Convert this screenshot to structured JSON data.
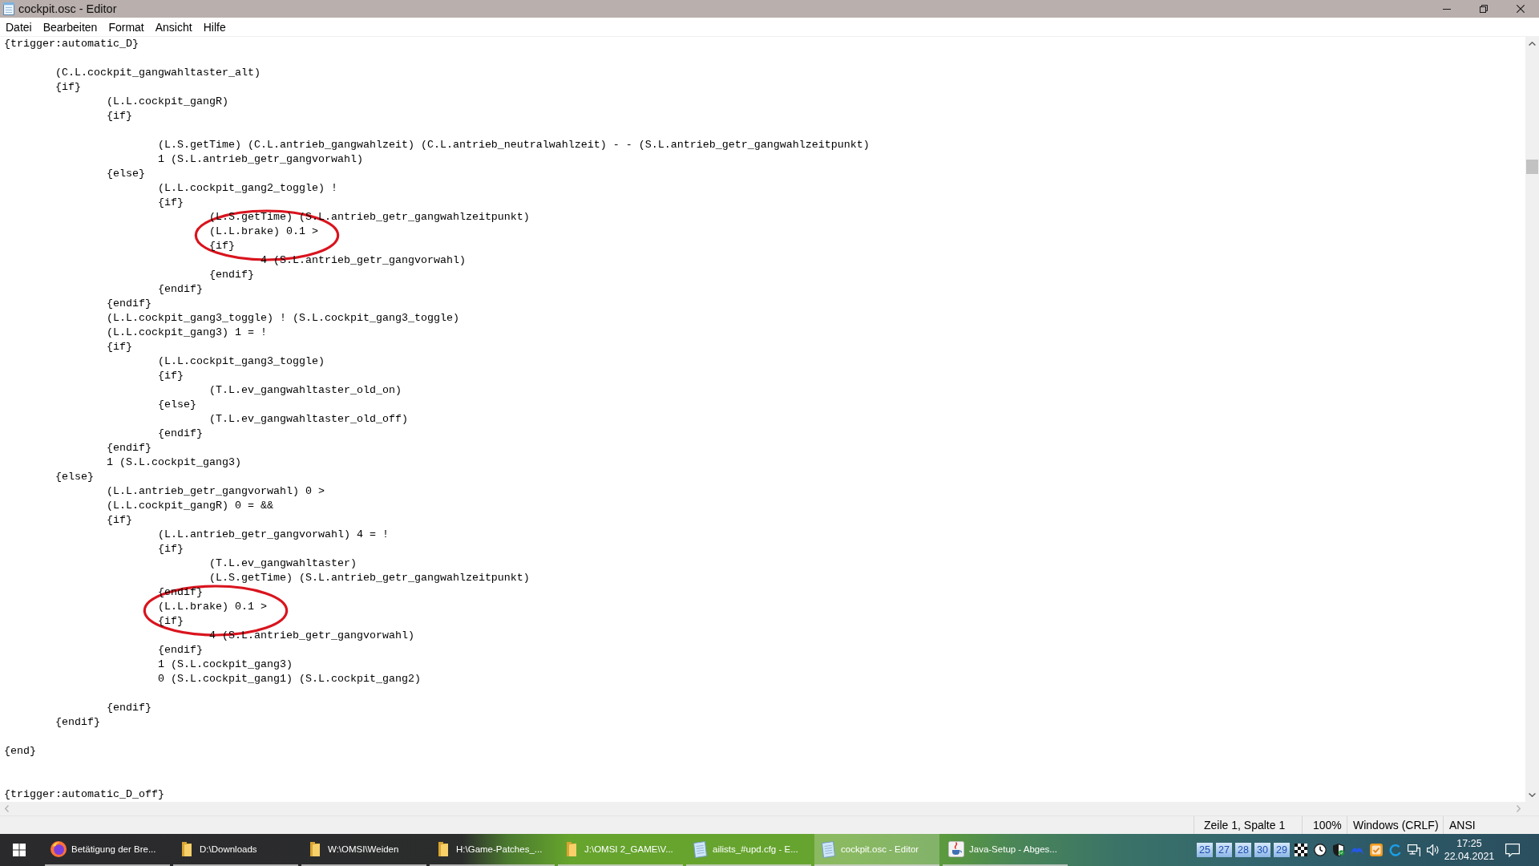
{
  "window": {
    "title": "cockpit.osc - Editor"
  },
  "menu": [
    "Datei",
    "Bearbeiten",
    "Format",
    "Ansicht",
    "Hilfe"
  ],
  "editor": {
    "lines": [
      {
        "kind": "code",
        "text": "{trigger:automatic_D}",
        "circled": false
      },
      {
        "kind": "blank"
      },
      {
        "kind": "code",
        "text": "\t(C.L.cockpit_gangwahltaster_alt)",
        "circled": false
      },
      {
        "kind": "code",
        "text": "\t{if}",
        "circled": false
      },
      {
        "kind": "code",
        "text": "\t\t(L.L.cockpit_gangR)",
        "circled": false
      },
      {
        "kind": "code",
        "text": "\t\t{if}",
        "circled": false
      },
      {
        "kind": "blank"
      },
      {
        "kind": "code",
        "text": "\t\t\t(L.S.getTime) (C.L.antrieb_gangwahlzeit) (C.L.antrieb_neutralwahlzeit) - - (S.L.antrieb_getr_gangwahlzeitpunkt)",
        "circled": false
      },
      {
        "kind": "code",
        "text": "\t\t\t1 (S.L.antrieb_getr_gangvorwahl)",
        "circled": false
      },
      {
        "kind": "code",
        "text": "\t\t{else}",
        "circled": false
      },
      {
        "kind": "code",
        "text": "\t\t\t(L.L.cockpit_gang2_toggle) !",
        "circled": false
      },
      {
        "kind": "code",
        "text": "\t\t\t{if}",
        "circled": false
      },
      {
        "kind": "code",
        "text": "\t\t\t\t(L.S.getTime) (S.L.antrieb_getr_gangwahlzeitpunkt)",
        "circled": false
      },
      {
        "kind": "code",
        "text": "\t\t\t\t(L.L.brake) 0.1 >",
        "circled": true
      },
      {
        "kind": "code",
        "text": "\t\t\t\t{if}",
        "circled": false
      },
      {
        "kind": "code",
        "text": "\t\t\t\t\t4 (S.L.antrieb_getr_gangvorwahl)",
        "circled": false
      },
      {
        "kind": "code",
        "text": "\t\t\t\t{endif}",
        "circled": false
      },
      {
        "kind": "code",
        "text": "\t\t\t{endif}",
        "circled": false
      },
      {
        "kind": "code",
        "text": "\t\t{endif}",
        "circled": false
      },
      {
        "kind": "code",
        "text": "\t\t(L.L.cockpit_gang3_toggle) ! (S.L.cockpit_gang3_toggle)",
        "circled": false
      },
      {
        "kind": "code",
        "text": "\t\t(L.L.cockpit_gang3) 1 = !",
        "circled": false
      },
      {
        "kind": "code",
        "text": "\t\t{if}",
        "circled": false
      },
      {
        "kind": "code",
        "text": "\t\t\t(L.L.cockpit_gang3_toggle)",
        "circled": false
      },
      {
        "kind": "code",
        "text": "\t\t\t{if}",
        "circled": false
      },
      {
        "kind": "code",
        "text": "\t\t\t\t(T.L.ev_gangwahltaster_old_on)",
        "circled": false
      },
      {
        "kind": "code",
        "text": "\t\t\t{else}",
        "circled": false
      },
      {
        "kind": "code",
        "text": "\t\t\t\t(T.L.ev_gangwahltaster_old_off)",
        "circled": false
      },
      {
        "kind": "code",
        "text": "\t\t\t{endif}",
        "circled": false
      },
      {
        "kind": "code",
        "text": "\t\t{endif}",
        "circled": false
      },
      {
        "kind": "code",
        "text": "\t\t1 (S.L.cockpit_gang3)",
        "circled": false
      },
      {
        "kind": "code",
        "text": "\t{else}",
        "circled": false
      },
      {
        "kind": "code",
        "text": "\t\t(L.L.antrieb_getr_gangvorwahl) 0 >",
        "circled": false
      },
      {
        "kind": "code",
        "text": "\t\t(L.L.cockpit_gangR) 0 = &&",
        "circled": false
      },
      {
        "kind": "code",
        "text": "\t\t{if}",
        "circled": false
      },
      {
        "kind": "code",
        "text": "\t\t\t(L.L.antrieb_getr_gangvorwahl) 4 = !",
        "circled": false
      },
      {
        "kind": "code",
        "text": "\t\t\t{if}",
        "circled": false
      },
      {
        "kind": "code",
        "text": "\t\t\t\t(T.L.ev_gangwahltaster)",
        "circled": false
      },
      {
        "kind": "code",
        "text": "\t\t\t\t(L.S.getTime) (S.L.antrieb_getr_gangwahlzeitpunkt)",
        "circled": false
      },
      {
        "kind": "code",
        "text": "\t\t\t{endif}",
        "circled": false
      },
      {
        "kind": "code",
        "text": "\t\t\t(L.L.brake) 0.1 >",
        "circled": true
      },
      {
        "kind": "code",
        "text": "\t\t\t{if}",
        "circled": false
      },
      {
        "kind": "code",
        "text": "\t\t\t\t4 (S.L.antrieb_getr_gangvorwahl)",
        "circled": false
      },
      {
        "kind": "code",
        "text": "\t\t\t{endif}",
        "circled": false
      },
      {
        "kind": "code",
        "text": "\t\t\t1 (S.L.cockpit_gang3)",
        "circled": false
      },
      {
        "kind": "code",
        "text": "\t\t\t0 (S.L.cockpit_gang1) (S.L.cockpit_gang2)",
        "circled": false
      },
      {
        "kind": "blank"
      },
      {
        "kind": "code",
        "text": "\t\t{endif}",
        "circled": false
      },
      {
        "kind": "code",
        "text": "\t{endif}",
        "circled": false
      },
      {
        "kind": "blank"
      },
      {
        "kind": "code",
        "text": "{end}",
        "circled": false
      },
      {
        "kind": "blank"
      },
      {
        "kind": "blank"
      },
      {
        "kind": "code",
        "text": "{trigger:automatic_D_off}",
        "circled": false
      }
    ]
  },
  "status_bar": {
    "position": "Zeile 1, Spalte 1",
    "zoom": "100%",
    "line_endings": "Windows (CRLF)",
    "encoding": "ANSI"
  },
  "taskbar": {
    "apps": [
      {
        "kind": "browser",
        "label": "Betätigung der Bre...",
        "selected": false
      },
      {
        "kind": "folder",
        "label": "D:\\Downloads",
        "selected": false
      },
      {
        "kind": "folder",
        "label": "W:\\OMSI\\Weiden",
        "selected": false
      },
      {
        "kind": "folder",
        "label": "H:\\Game-Patches_...",
        "selected": false
      },
      {
        "kind": "folder",
        "label": "J:\\OMSI 2_GAME\\V...",
        "selected": false
      },
      {
        "kind": "editor",
        "label": "ailists_#upd.cfg - E...",
        "selected": false
      },
      {
        "kind": "editor",
        "label": "cockpit.osc - Editor",
        "selected": true
      },
      {
        "kind": "installer",
        "label": "Java-Setup - Abges...",
        "selected": false
      }
    ],
    "tray_counters": [
      "25",
      "27",
      "28",
      "30",
      "29"
    ],
    "time": "17:25",
    "date": "22.04.2021"
  }
}
